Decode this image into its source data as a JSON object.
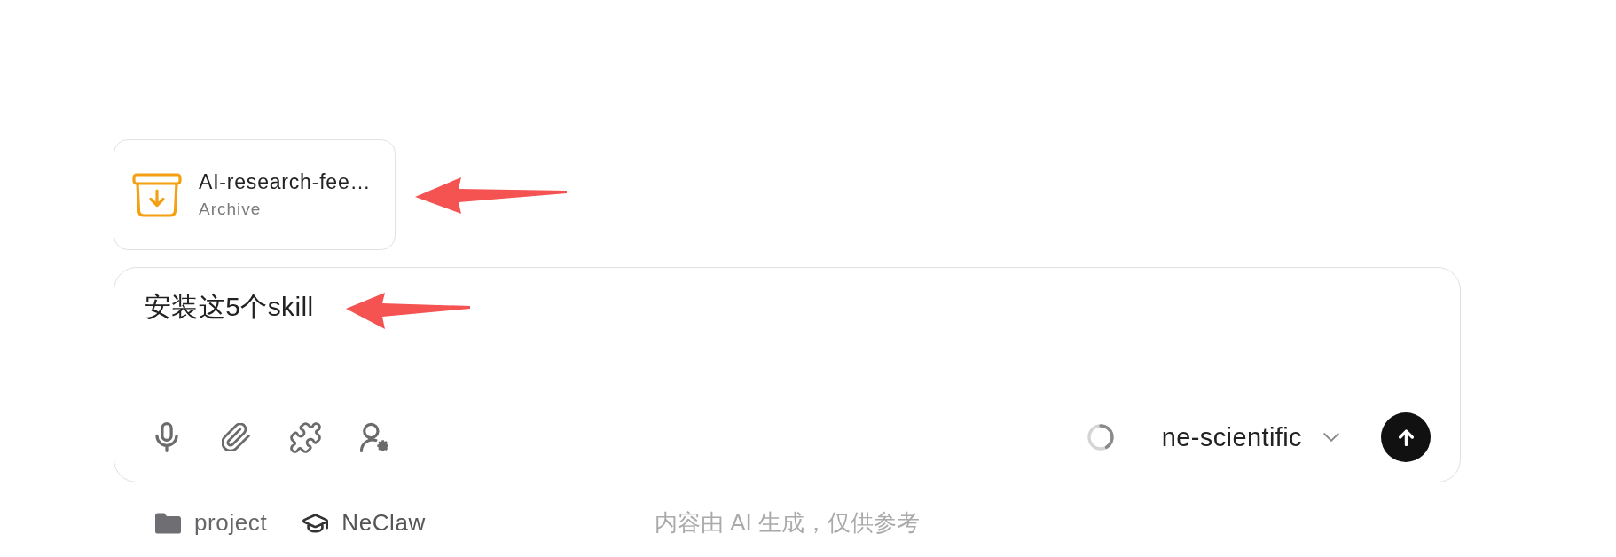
{
  "attachment": {
    "name": "AI-research-fee…",
    "type": "Archive"
  },
  "composer": {
    "value": "安装这5个skill",
    "tools": [
      {
        "kind": "mic"
      },
      {
        "kind": "attach"
      },
      {
        "kind": "plugin"
      },
      {
        "kind": "persona"
      }
    ],
    "model": "ne-scientific"
  },
  "footer": {
    "items": [
      {
        "kind": "folder",
        "label": "project"
      },
      {
        "kind": "cap",
        "label": "NeClaw"
      }
    ],
    "disclaimer": "内容由 AI 生成，仅供参考"
  }
}
